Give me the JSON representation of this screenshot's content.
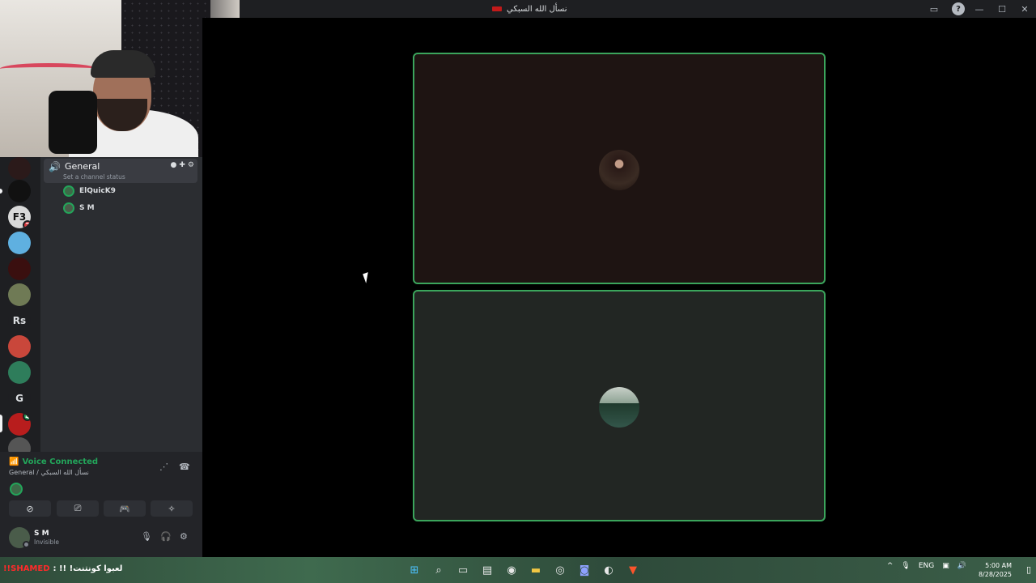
{
  "titlebar": {
    "title": "نسأل الله السبكي",
    "help": "?",
    "minimize": "—",
    "maximize": "☐",
    "close": "✕",
    "inbox": "▭"
  },
  "rail": {
    "servers": [
      {
        "label": ""
      },
      {
        "label": ""
      },
      {
        "label": "F3",
        "badge": "2"
      },
      {
        "label": ""
      },
      {
        "label": ""
      },
      {
        "label": ""
      },
      {
        "label": "Rs"
      },
      {
        "label": ""
      },
      {
        "label": ""
      },
      {
        "label": "G"
      },
      {
        "label": "",
        "badge": "4"
      },
      {
        "label": ""
      }
    ]
  },
  "channel": {
    "name": "General",
    "status_placeholder": "Set a channel status",
    "members": [
      "ElQuicK9",
      "S M"
    ]
  },
  "voice": {
    "title": "Voice Connected",
    "subtitle": "General / نسأل الله السبكي"
  },
  "user": {
    "name": "S M",
    "status": "Invisible"
  },
  "taskbar": {
    "ticker_red": "!!SHAMED",
    "ticker_text": ": !! !لعبوا كونتنت",
    "language": "ENG",
    "time": "5:00 AM",
    "date": "8/28/2025",
    "discord_badge": "3"
  },
  "colors": {
    "accent_green": "#3ba55c",
    "voice_green": "#23a55a",
    "badge_red": "#da373c"
  }
}
